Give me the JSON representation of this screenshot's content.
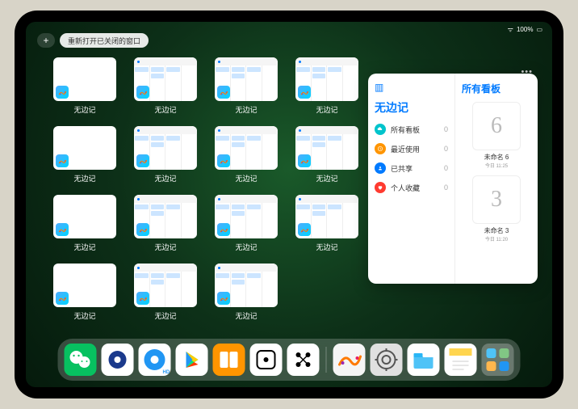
{
  "status": {
    "battery": "100%",
    "wifi": "●●●"
  },
  "topControls": {
    "plus": "+",
    "reopen": "重新打开已关闭的窗口"
  },
  "thumbnail_label": "无边记",
  "thumbnails": [
    {
      "type": "blank"
    },
    {
      "type": "calendar"
    },
    {
      "type": "calendar"
    },
    {
      "type": "calendar"
    },
    {
      "type": "blank"
    },
    {
      "type": "calendar"
    },
    {
      "type": "calendar"
    },
    {
      "type": "calendar"
    },
    {
      "type": "blank"
    },
    {
      "type": "calendar"
    },
    {
      "type": "calendar"
    },
    {
      "type": "calendar"
    },
    {
      "type": "blank"
    },
    {
      "type": "calendar"
    },
    {
      "type": "calendar"
    }
  ],
  "sidePanel": {
    "more": "•••",
    "left_title": "无边记",
    "items": [
      {
        "icon": "cloud",
        "color": "#00c4cc",
        "label": "所有看板",
        "count": "0"
      },
      {
        "icon": "clock",
        "color": "#ff9500",
        "label": "最近使用",
        "count": "0"
      },
      {
        "icon": "person",
        "color": "#007aff",
        "label": "已共享",
        "count": "0"
      },
      {
        "icon": "heart",
        "color": "#ff3b30",
        "label": "个人收藏",
        "count": "0"
      }
    ],
    "right_title": "所有看板",
    "boards": [
      {
        "glyph": "6",
        "label": "未命名 6",
        "sub": "今日 11:25"
      },
      {
        "glyph": "3",
        "label": "未命名 3",
        "sub": "今日 11:20"
      }
    ]
  },
  "dock": [
    {
      "name": "wechat"
    },
    {
      "name": "app-blue-circle"
    },
    {
      "name": "app-blue-pause"
    },
    {
      "name": "play-store"
    },
    {
      "name": "books"
    },
    {
      "name": "dice"
    },
    {
      "name": "dots-app"
    },
    {
      "sep": true
    },
    {
      "name": "freeform"
    },
    {
      "name": "settings"
    },
    {
      "name": "files"
    },
    {
      "name": "notes"
    },
    {
      "name": "app-library"
    }
  ]
}
